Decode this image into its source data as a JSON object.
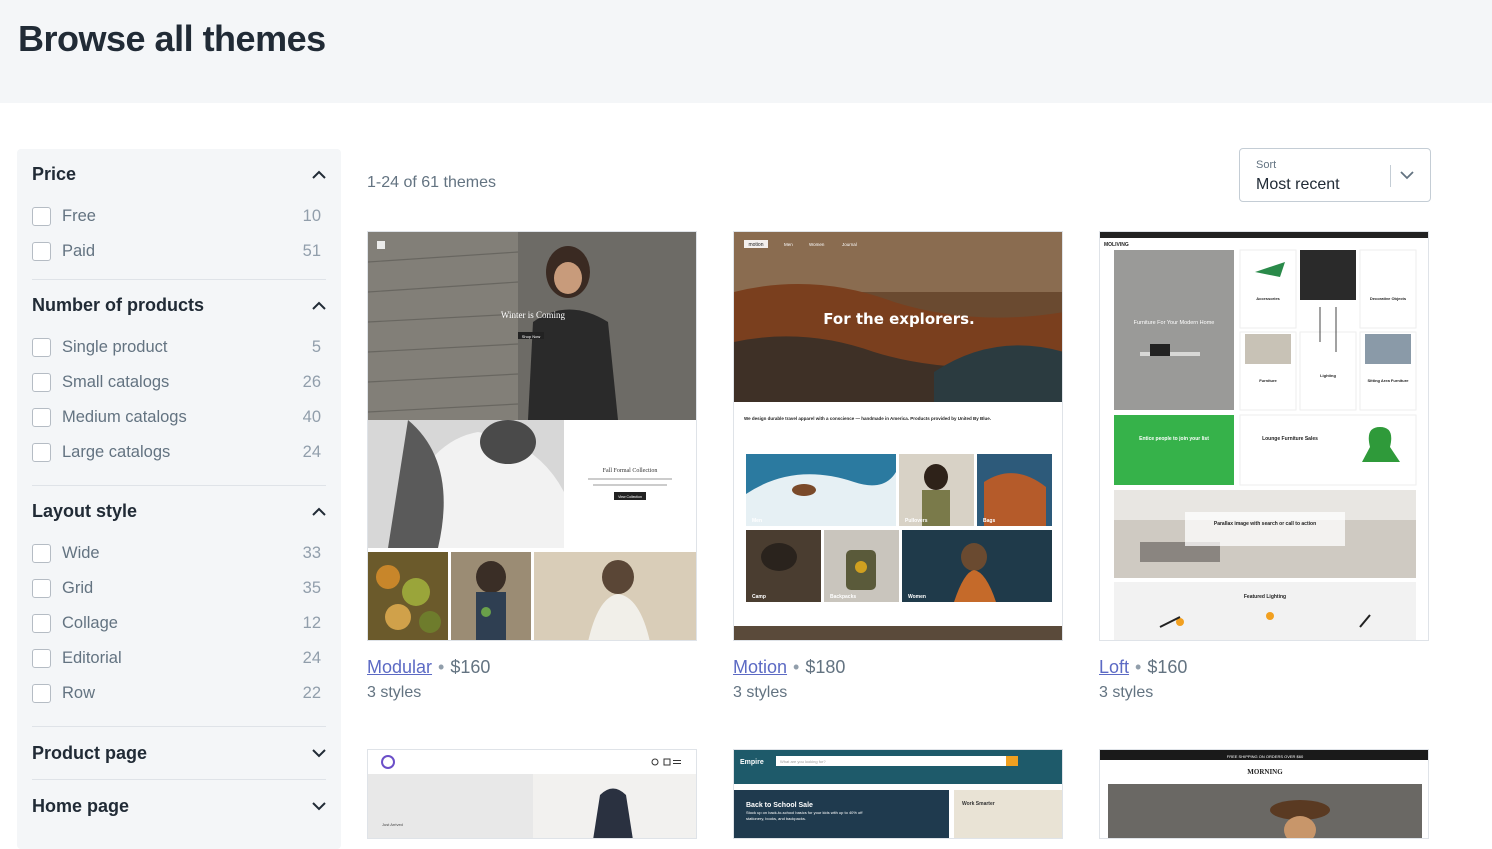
{
  "page": {
    "title": "Browse all themes"
  },
  "filters": [
    {
      "title": "Price",
      "expanded": true,
      "options": [
        {
          "label": "Free",
          "count": "10"
        },
        {
          "label": "Paid",
          "count": "51"
        }
      ]
    },
    {
      "title": "Number of products",
      "expanded": true,
      "options": [
        {
          "label": "Single product",
          "count": "5"
        },
        {
          "label": "Small catalogs",
          "count": "26"
        },
        {
          "label": "Medium catalogs",
          "count": "40"
        },
        {
          "label": "Large catalogs",
          "count": "24"
        }
      ]
    },
    {
      "title": "Layout style",
      "expanded": true,
      "options": [
        {
          "label": "Wide",
          "count": "33"
        },
        {
          "label": "Grid",
          "count": "35"
        },
        {
          "label": "Collage",
          "count": "12"
        },
        {
          "label": "Editorial",
          "count": "24"
        },
        {
          "label": "Row",
          "count": "22"
        }
      ]
    },
    {
      "title": "Product page",
      "expanded": false,
      "options": []
    },
    {
      "title": "Home page",
      "expanded": false,
      "options": []
    }
  ],
  "results": {
    "count_text": "1-24 of 61 themes"
  },
  "sort": {
    "label": "Sort",
    "value": "Most recent"
  },
  "themes": [
    {
      "name": "Modular",
      "price": "$160",
      "styles": "3 styles",
      "preview": {
        "hero_text": "Winter is Coming",
        "hero_button": "Shop Now",
        "section_title": "Fall Formal Collection",
        "section_button": "View Collection"
      }
    },
    {
      "name": "Motion",
      "price": "$180",
      "styles": "3 styles",
      "preview": {
        "logo": "motion",
        "nav": [
          "Men",
          "Women",
          "Journal"
        ],
        "hero_text": "For the explorers.",
        "tagline": "We design durable travel apparel with a conscience — handmade in America. Products provided by United By Blue.",
        "tiles": [
          "Men",
          "Pullovers",
          "Bags",
          "Camp",
          "Backpacks",
          "Women"
        ]
      }
    },
    {
      "name": "Loft",
      "price": "$160",
      "styles": "3 styles",
      "preview": {
        "logo": "MOLIVING",
        "hero_text": "Furniture For Your Modern Home",
        "cards": [
          "Accessories",
          "Decorative Objects",
          "Furniture",
          "Lighting",
          "Sitting Area Furniture"
        ],
        "promo": "Entice people to join your list",
        "lounge": "Lounge Furniture Sales",
        "parallax": "Parallax image with search or call to action",
        "featured": "Featured Lighting"
      }
    }
  ],
  "themes_row2": [
    {
      "label": "Just Arrived"
    },
    {
      "logo": "Empire",
      "search_placeholder": "What are you looking for?",
      "promo_title": "Back to School Sale",
      "promo_text": "Stock up on back-to-school basics for your kids with up to 40% off stationery, books, and backpacks.",
      "side_title": "Work Smarter"
    },
    {
      "banner": "FREE SHIPPING ON ORDERS OVER $60",
      "logo": "MORNING"
    }
  ],
  "colors": {
    "accent": "#5c6ac4",
    "hero_bg": "#f4f6f8",
    "text": "#212b36",
    "muted": "#637381"
  }
}
